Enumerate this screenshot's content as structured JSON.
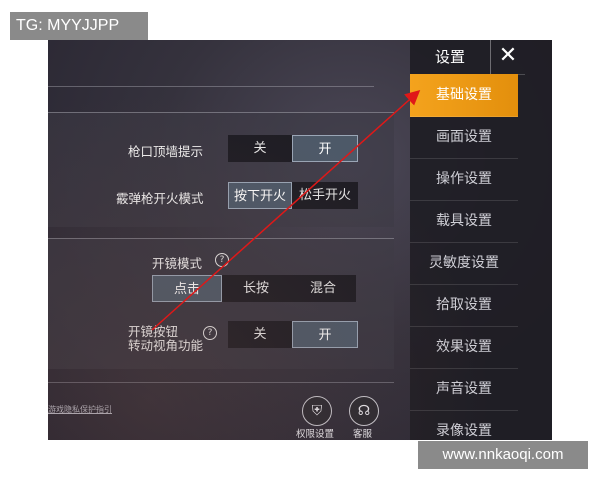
{
  "watermarks": {
    "tg": "TG: MYYJJPP",
    "url": "www.nnkaoqi.com"
  },
  "settings": {
    "muzzle_wall_hint": {
      "label": "枪口顶墙提示",
      "options": [
        "关",
        "开"
      ],
      "selected": 1
    },
    "shotgun_fire_mode": {
      "label": "霰弹枪开火模式",
      "options": [
        "按下开火",
        "松手开火"
      ],
      "selected": 0
    },
    "scope_mode": {
      "label": "开镜模式",
      "help": "?",
      "options": [
        "点击",
        "长按",
        "混合"
      ],
      "selected": 0
    },
    "scope_view_rotate": {
      "label_line1": "开镜按钮",
      "label_line2": "转动视角功能",
      "help": "?",
      "options": [
        "关",
        "开"
      ],
      "selected": 1
    }
  },
  "footer": {
    "privacy_link": "游戏隐私保护指引",
    "permission": {
      "label": "权限设置",
      "icon": "shield-key-icon"
    },
    "service": {
      "label": "客服",
      "icon": "headset-icon"
    }
  },
  "sidebar": {
    "title": "设置",
    "close": "✕",
    "items": [
      {
        "label": "基础设置",
        "active": true
      },
      {
        "label": "画面设置"
      },
      {
        "label": "操作设置"
      },
      {
        "label": "载具设置"
      },
      {
        "label": "灵敏度设置"
      },
      {
        "label": "拾取设置"
      },
      {
        "label": "效果设置"
      },
      {
        "label": "声音设置"
      },
      {
        "label": "录像设置"
      }
    ]
  },
  "colors": {
    "accent": "#f4a31d",
    "annotation_arrow": "#e01818",
    "selected_option": "#4d5968"
  }
}
